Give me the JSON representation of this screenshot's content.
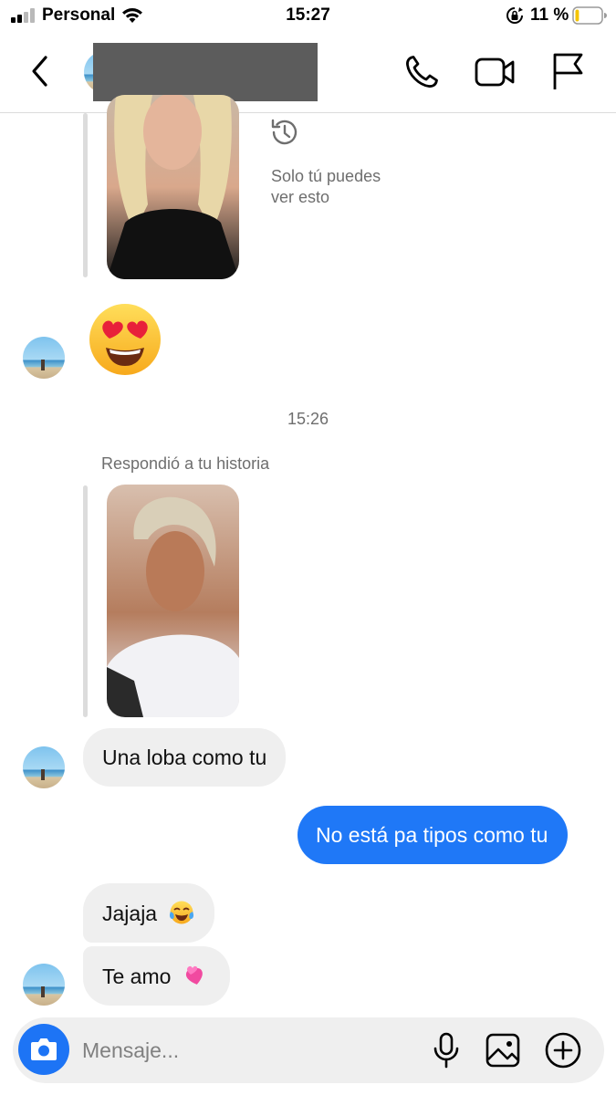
{
  "status_bar": {
    "carrier": "Personal",
    "time": "15:27",
    "battery_percent": "11 %",
    "battery_level": 0.11,
    "icons": [
      "signal-icon",
      "wifi-icon",
      "orientation-lock-icon",
      "battery-icon"
    ]
  },
  "header": {
    "contact_name": "",
    "icons": [
      "back-chevron-icon",
      "phone-icon",
      "video-camera-icon",
      "flag-icon"
    ]
  },
  "conversation": {
    "story_private_note": "Solo tú puedes\nver esto",
    "history_icon": "history-clock-icon",
    "reaction_emoji": "😍",
    "time_separator": "15:26",
    "replied_to_story": "Respondió a tu historia",
    "messages": [
      {
        "from": "them",
        "text": "Una loba como tu"
      },
      {
        "from": "me",
        "text": "No está pa tipos como tu"
      },
      {
        "from": "them",
        "text": "Jajaja",
        "emoji": "😂"
      },
      {
        "from": "them",
        "text": "Te amo",
        "emoji": "💞"
      }
    ]
  },
  "composer": {
    "placeholder": "Mensaje...",
    "icons": [
      "camera-icon",
      "microphone-icon",
      "gallery-icon",
      "plus-circle-icon"
    ]
  },
  "colors": {
    "accent_blue": "#1f78f7",
    "camera_blue": "#1d74f5",
    "incoming_bubble": "#efefef",
    "muted_text": "#6e6e6e",
    "redaction": "#5c5c5c"
  }
}
